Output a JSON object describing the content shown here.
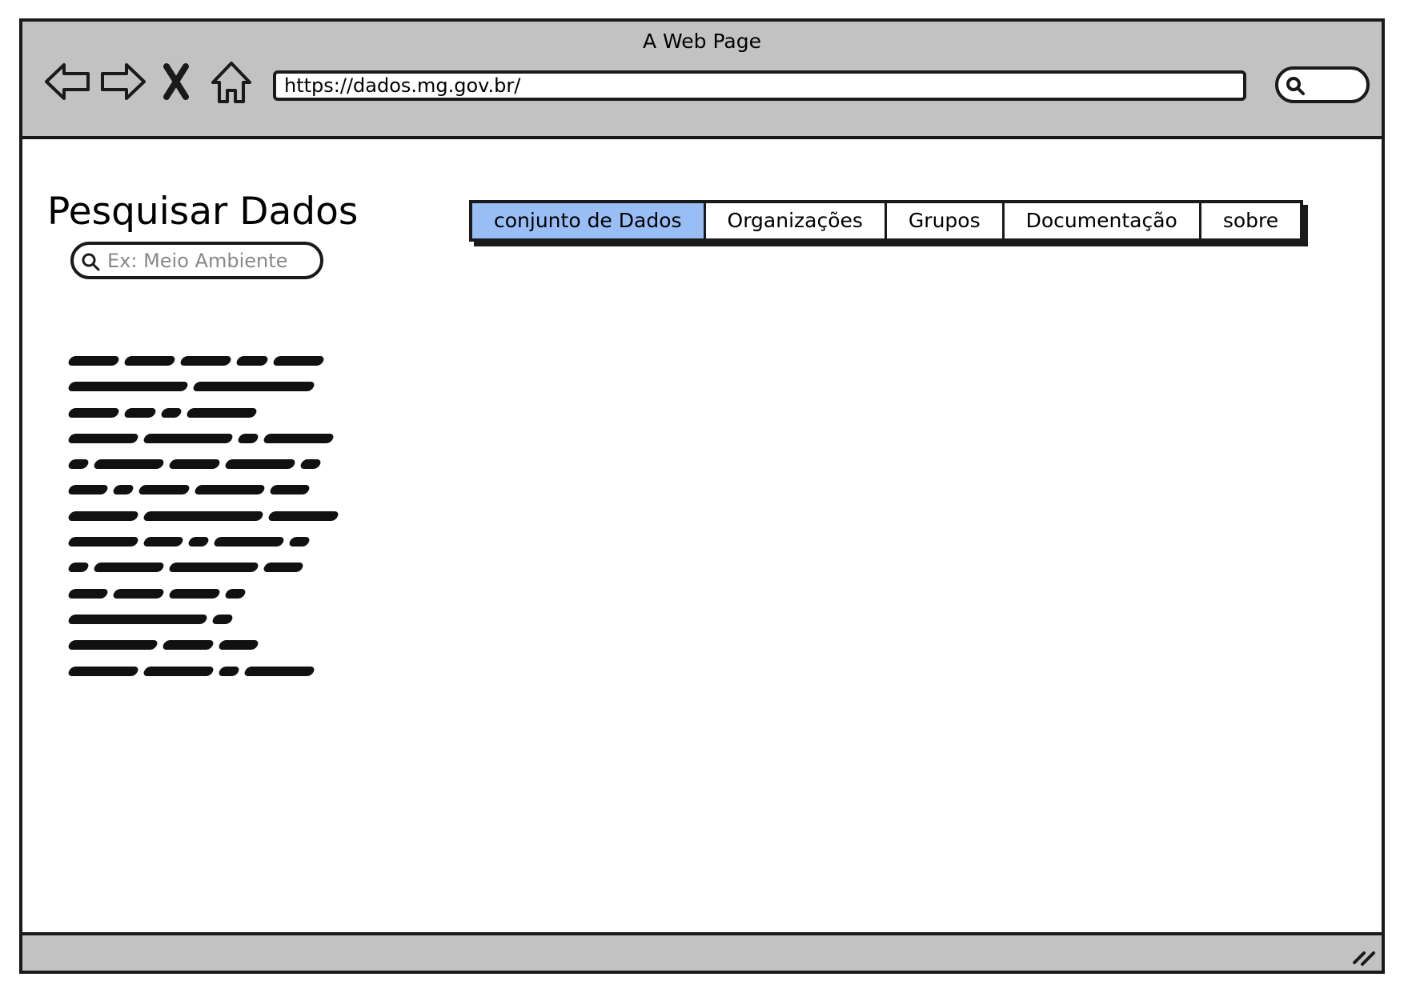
{
  "browser": {
    "title": "A Web Page",
    "url": "https://dados.mg.gov.br/",
    "icons": [
      "back-arrow-icon",
      "forward-arrow-icon",
      "close-x-icon",
      "home-icon",
      "search-icon",
      "resize-grip-icon"
    ]
  },
  "sidebar": {
    "title": "Pesquisar Dados",
    "search_placeholder": "Ex: Meio Ambiente"
  },
  "nav": {
    "tabs": [
      {
        "label": "conjunto de Dados",
        "active": true
      },
      {
        "label": "Organizações",
        "active": false
      },
      {
        "label": "Grupos",
        "active": false
      },
      {
        "label": "Documentação",
        "active": false
      },
      {
        "label": "sobre",
        "active": false
      }
    ]
  },
  "colors": {
    "chrome": "#c2c2c2",
    "active_tab": "#99bdf5",
    "border": "#1a1a1a"
  }
}
